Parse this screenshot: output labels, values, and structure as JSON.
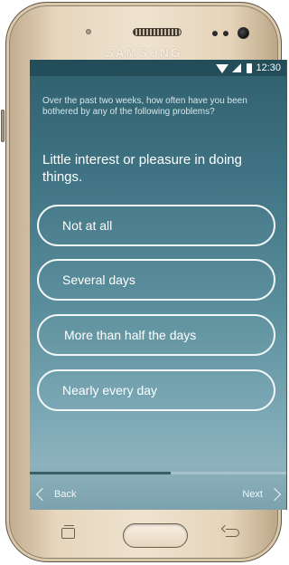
{
  "device": {
    "brand": "SAMSUNG"
  },
  "status_bar": {
    "time": "12:30",
    "icons": [
      "wifi-icon",
      "signal-icon",
      "battery-icon"
    ]
  },
  "survey": {
    "intro": "Over the past two weeks, how often have you been bothered by any of the following problems?",
    "question": "Little interest or pleasure in doing things.",
    "answers": [
      {
        "label": "Not at all"
      },
      {
        "label": "Several days"
      },
      {
        "label": "More than half the days"
      },
      {
        "label": "Nearly every day"
      }
    ],
    "progress_fraction": 0.55
  },
  "navigation": {
    "back_label": "Back",
    "next_label": "Next"
  },
  "colors": {
    "screen_top": "#2f5f6d",
    "screen_bottom": "#8cb2bd",
    "accent_text": "#ffffff",
    "phone_body": "#e6d6bd"
  }
}
